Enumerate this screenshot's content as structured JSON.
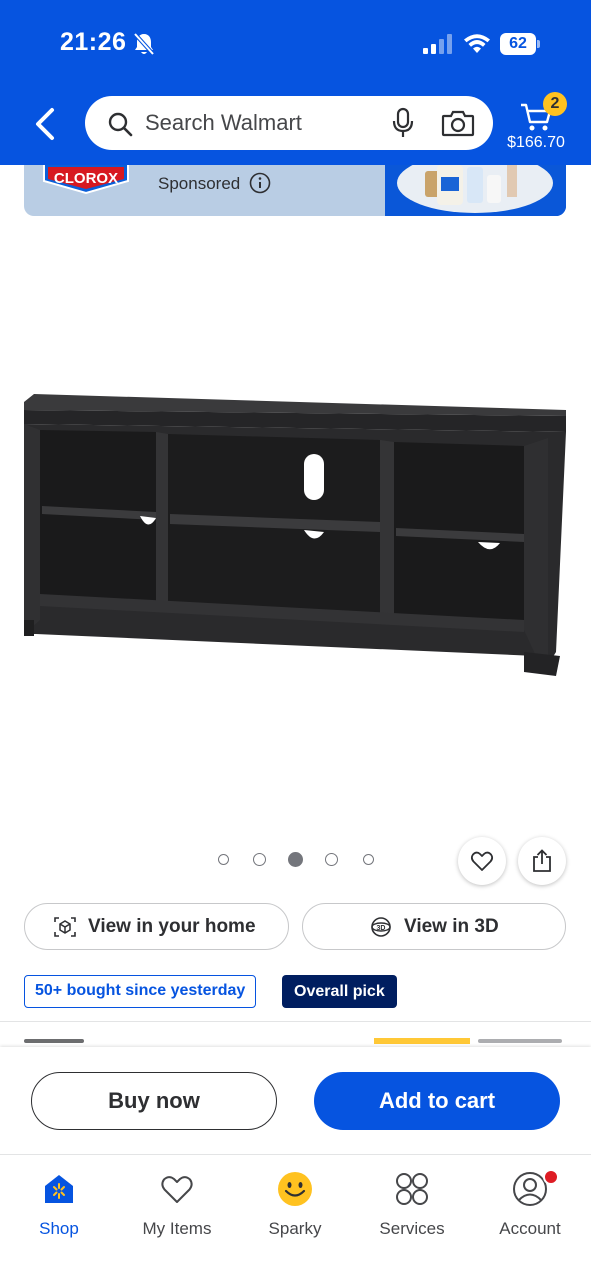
{
  "status_bar": {
    "time": "21:26",
    "battery": "62",
    "icons": [
      "bell-off-icon",
      "signal-icon",
      "wifi-icon",
      "battery-icon"
    ]
  },
  "header": {
    "search_placeholder": "Search Walmart",
    "cart_count": "2",
    "cart_total": "$166.70",
    "colors": {
      "brand_blue": "#0654e0",
      "spark_yellow": "#ffc220"
    }
  },
  "ad": {
    "brand_logo": "CLOROX",
    "sponsored_label": "Sponsored"
  },
  "product": {
    "carousel": {
      "total": 5,
      "active_index": 2
    },
    "view_home_label": "View in your home",
    "view_3d_label": "View in 3D",
    "badge_bought": "50+ bought since yesterday",
    "badge_pick": "Overall pick"
  },
  "purchase": {
    "buy_now_label": "Buy now",
    "add_to_cart_label": "Add to cart"
  },
  "bottom_nav": {
    "items": [
      {
        "label": "Shop",
        "icon": "shop-icon",
        "active": true
      },
      {
        "label": "My Items",
        "icon": "heart-icon",
        "active": false
      },
      {
        "label": "Sparky",
        "icon": "sparky-icon",
        "active": false
      },
      {
        "label": "Services",
        "icon": "services-icon",
        "active": false
      },
      {
        "label": "Account",
        "icon": "account-icon",
        "active": false
      }
    ]
  }
}
